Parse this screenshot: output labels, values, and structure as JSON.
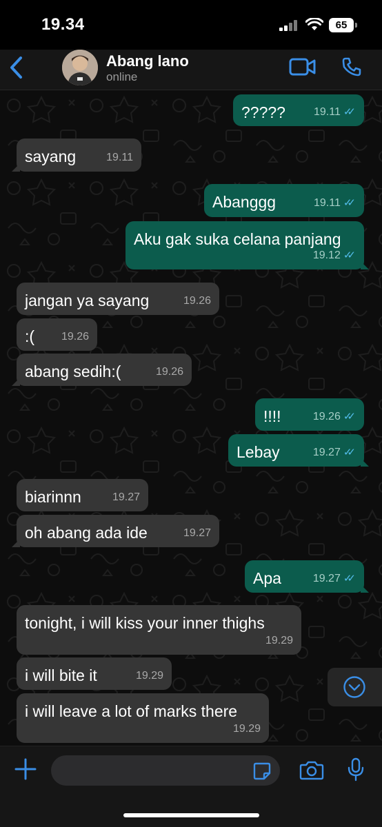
{
  "status_bar": {
    "time": "19.34",
    "battery": "65"
  },
  "header": {
    "name": "Abang lano",
    "status": "online"
  },
  "messages": [
    {
      "dir": "out",
      "text": "?????",
      "time": "19.11",
      "read": true
    },
    {
      "dir": "in",
      "text": "sayang",
      "time": "19.11"
    },
    {
      "dir": "out",
      "text": "Abanggg",
      "time": "19.11",
      "read": true
    },
    {
      "dir": "out",
      "text": "Aku gak suka celana panjang",
      "time": "19.12",
      "read": true
    },
    {
      "dir": "in",
      "text": "jangan ya sayang",
      "time": "19.26"
    },
    {
      "dir": "in",
      "text": ":(",
      "time": "19.26"
    },
    {
      "dir": "in",
      "text": "abang sedih:(",
      "time": "19.26"
    },
    {
      "dir": "out",
      "text": "!!!!",
      "time": "19.26",
      "read": true
    },
    {
      "dir": "out",
      "text": "Lebay",
      "time": "19.27",
      "read": true
    },
    {
      "dir": "in",
      "text": "biarinnn",
      "time": "19.27"
    },
    {
      "dir": "in",
      "text": "oh abang ada ide",
      "time": "19.27"
    },
    {
      "dir": "out",
      "text": "Apa",
      "time": "19.27",
      "read": true
    },
    {
      "dir": "in",
      "text": "tonight, i will kiss your inner thighs",
      "time": "19.29"
    },
    {
      "dir": "in",
      "text": "i will bite it",
      "time": "19.29"
    },
    {
      "dir": "in",
      "text": "i will leave a lot of marks there",
      "time": "19.29"
    }
  ],
  "colors": {
    "accent": "#3a8ee6",
    "outgoing": "#0c5c4d",
    "incoming": "#363636",
    "read_tick": "#53bdeb"
  },
  "icons": [
    "back-chevron-icon",
    "video-call-icon",
    "phone-icon",
    "plus-icon",
    "sticker-icon",
    "camera-icon",
    "mic-icon",
    "scroll-down-icon"
  ]
}
